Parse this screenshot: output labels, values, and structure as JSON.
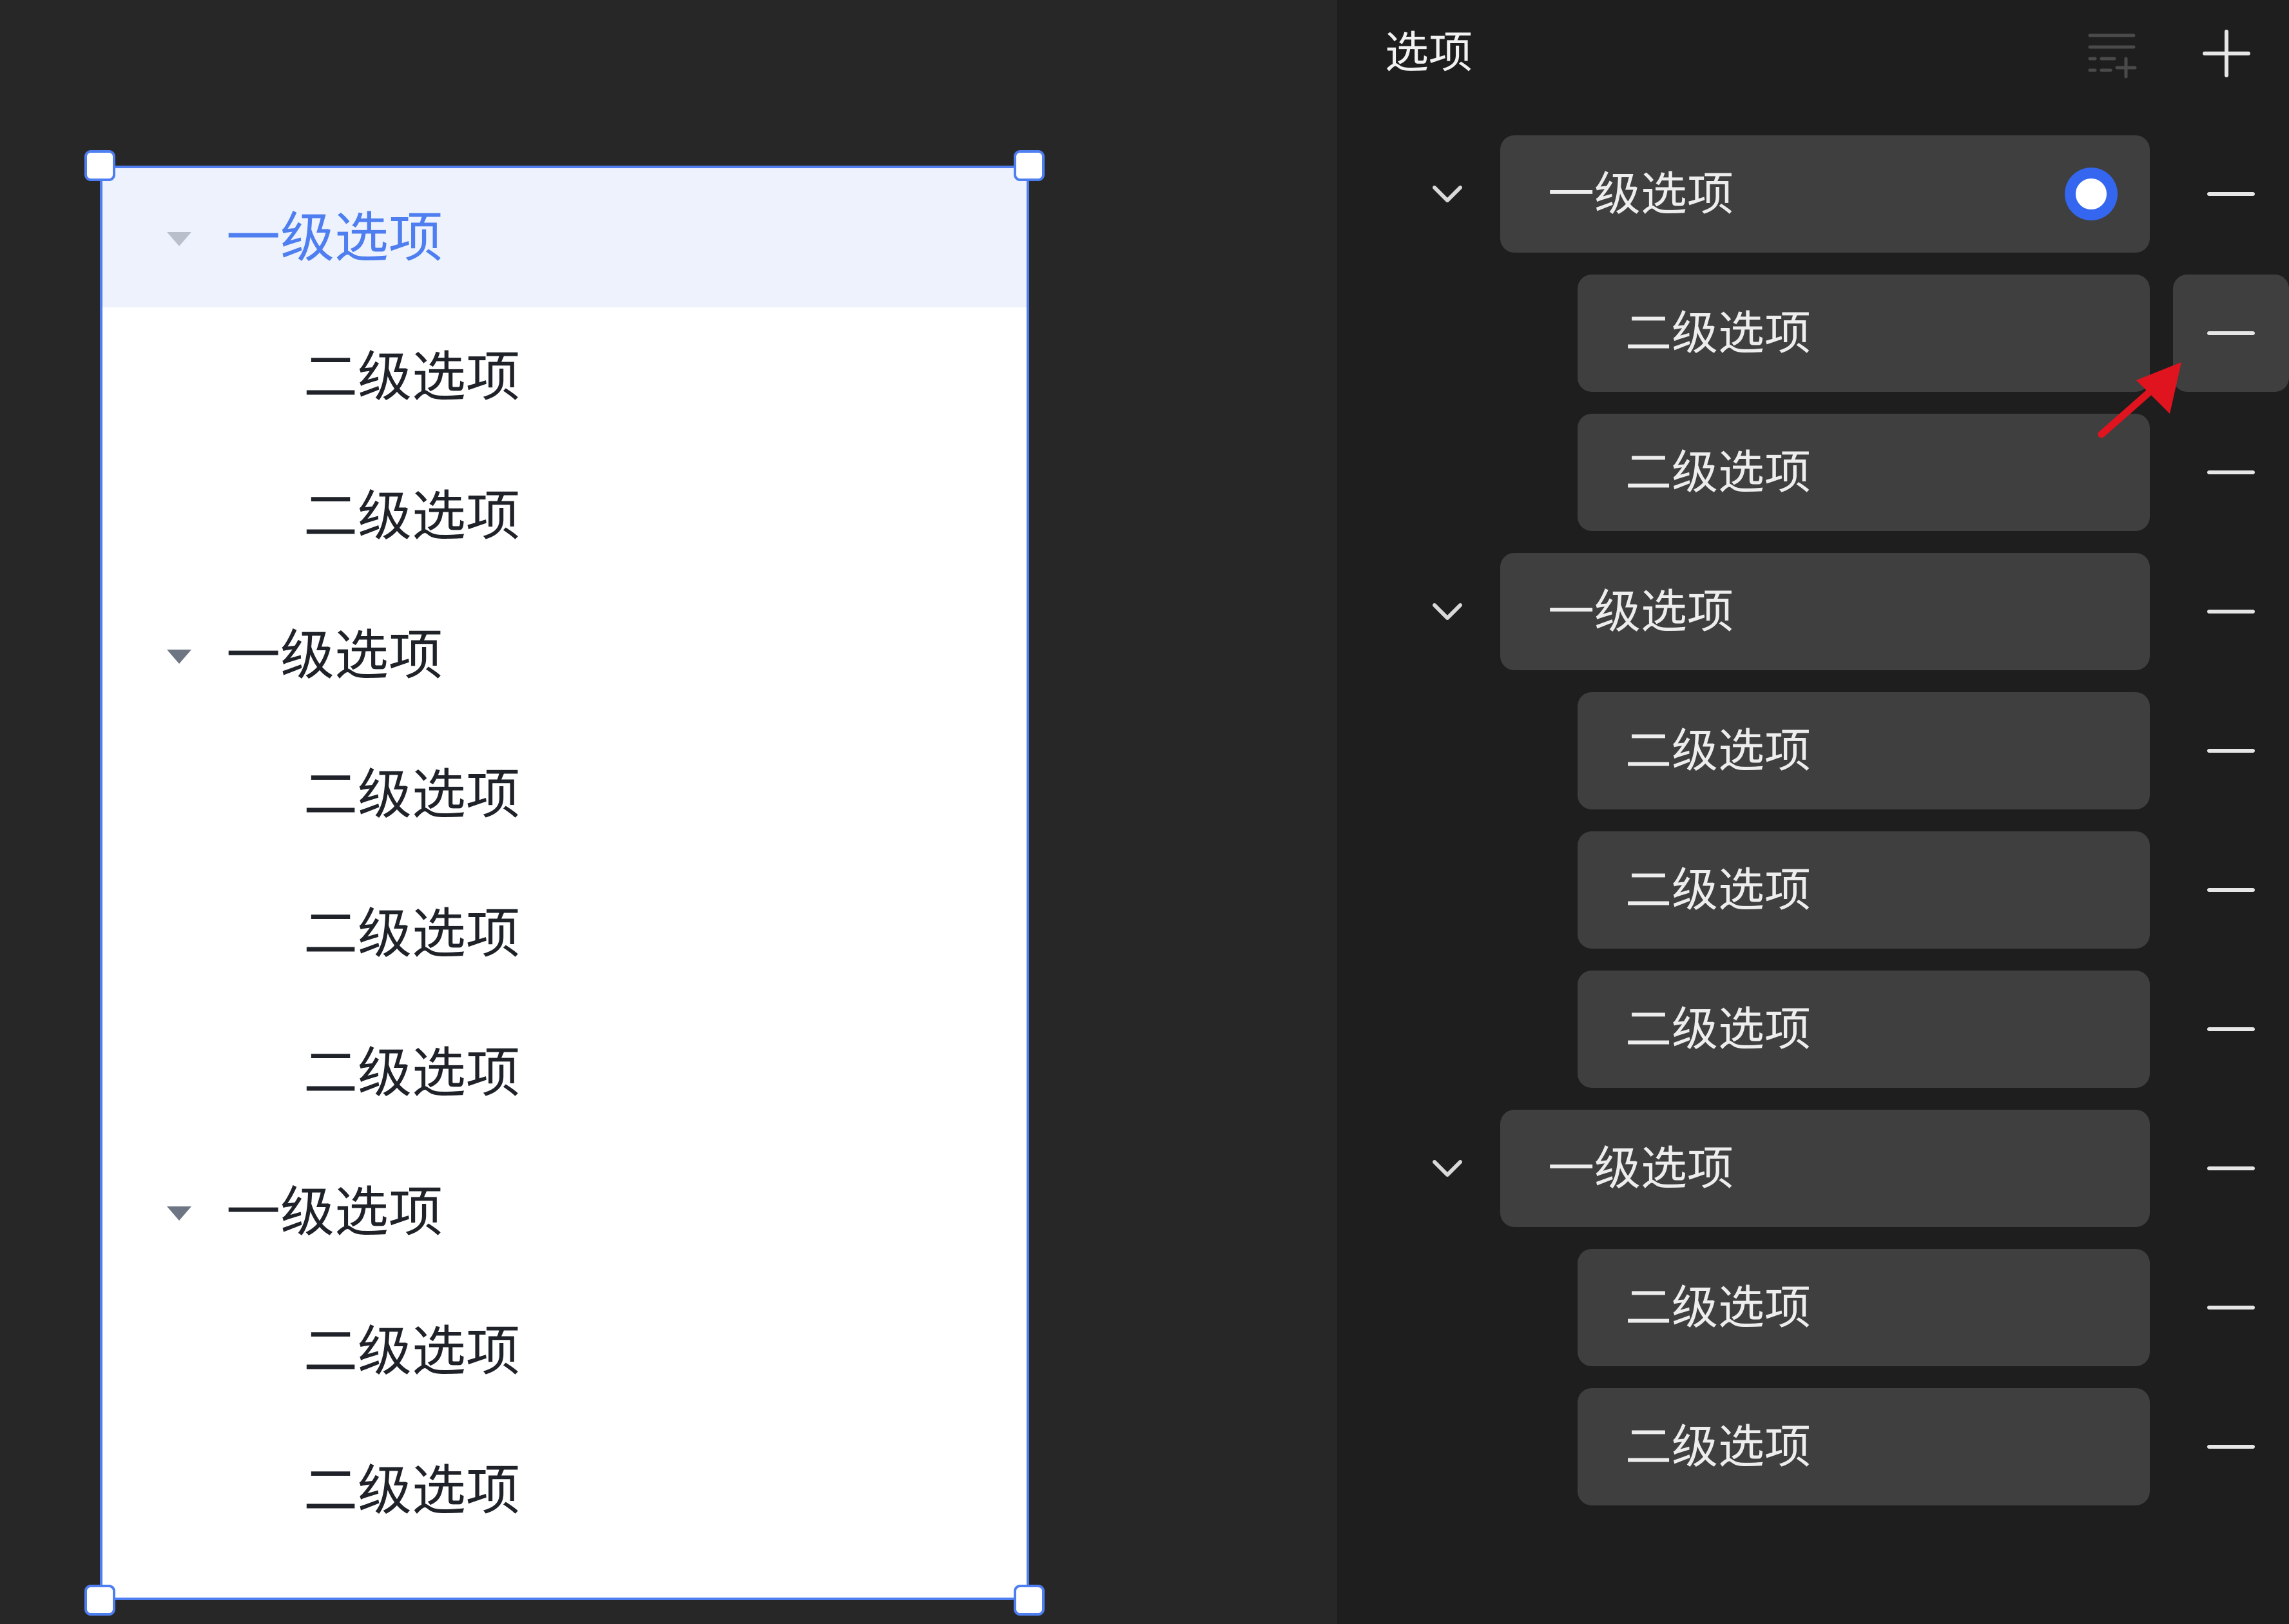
{
  "canvas": {
    "tree": [
      {
        "label": "一级选项",
        "children": [
          "二级选项",
          "二级选项"
        ],
        "active": true
      },
      {
        "label": "一级选项",
        "children": [
          "二级选项",
          "二级选项",
          "二级选项"
        ],
        "active": false
      },
      {
        "label": "一级选项",
        "children": [
          "二级选项",
          "二级选项"
        ],
        "active": false
      }
    ]
  },
  "panel": {
    "title": "选项",
    "icons": {
      "batch_add": "add-list-icon",
      "add": "plus-icon",
      "remove": "minus-icon",
      "expand": "chevron-down-icon"
    },
    "groups": [
      {
        "label": "一级选项",
        "selected": true,
        "children": [
          "二级选项",
          "二级选项"
        ]
      },
      {
        "label": "一级选项",
        "selected": false,
        "children": [
          "二级选项",
          "二级选项",
          "二级选项"
        ]
      },
      {
        "label": "一级选项",
        "selected": false,
        "children": [
          "二级选项",
          "二级选项"
        ]
      }
    ]
  },
  "colors": {
    "accent": "#4e7ef0",
    "radio": "#3466f0",
    "panel_bg": "#1e1e1e",
    "option_bg": "#3f3f3f",
    "annotation_arrow": "#e0141e"
  }
}
